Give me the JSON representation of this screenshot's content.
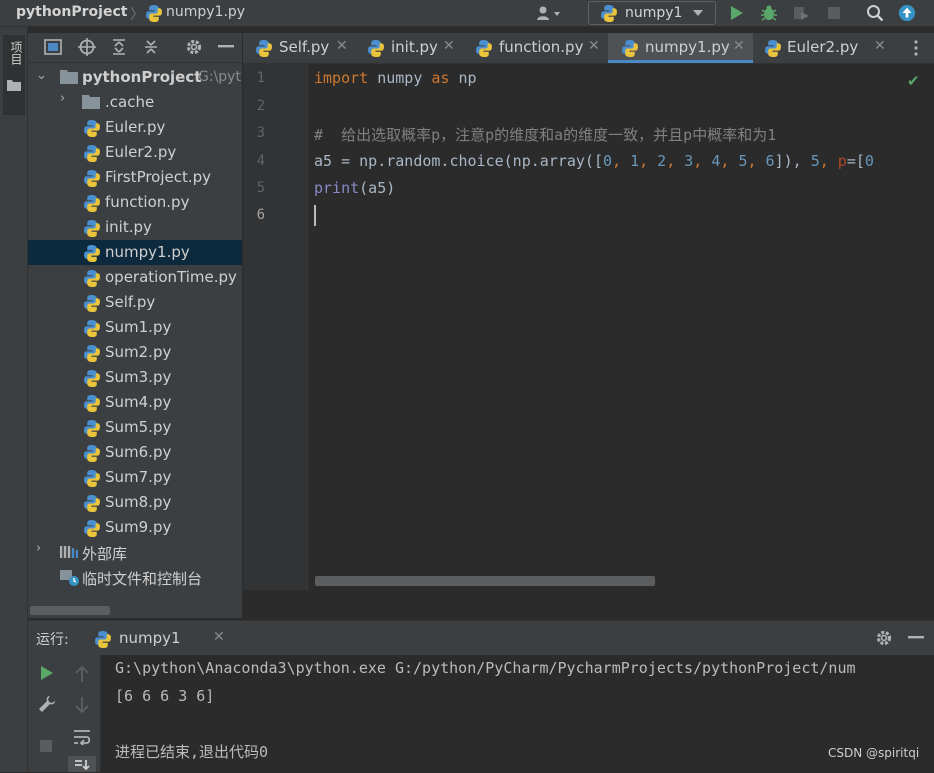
{
  "titlebar": {
    "project": "pythonProject",
    "separator": "〉",
    "file": "numpy1.py",
    "run_config": "numpy1"
  },
  "sidebar_tab": "项目",
  "project_tree": {
    "root": "pythonProject",
    "root_path": "G:\\pyt",
    "cache_folder": ".cache",
    "files": [
      "Euler.py",
      "Euler2.py",
      "FirstProject.py",
      "function.py",
      "init.py",
      "numpy1.py",
      "operationTime.py",
      "Self.py",
      "Sum1.py",
      "Sum2.py",
      "Sum3.py",
      "Sum4.py",
      "Sum5.py",
      "Sum6.py",
      "Sum7.py",
      "Sum8.py",
      "Sum9.py"
    ],
    "selected_file": "numpy1.py",
    "external_libs": "外部库",
    "scratches": "临时文件和控制台"
  },
  "tabs": [
    {
      "label": "Self.py",
      "active": false
    },
    {
      "label": "init.py",
      "active": false
    },
    {
      "label": "function.py",
      "active": false
    },
    {
      "label": "numpy1.py",
      "active": true
    },
    {
      "label": "Euler2.py",
      "active": false
    }
  ],
  "editor": {
    "line_numbers": [
      "1",
      "2",
      "3",
      "4",
      "5",
      "6"
    ],
    "line1": {
      "kw1": "import",
      "mod": " numpy ",
      "kw2": "as",
      "alias": " np"
    },
    "line3": "#  给出选取概率p，注意p的维度和a的维度一致，并且p中概率和为1",
    "line4": {
      "a": "a5 = np.random.choice(np.array([",
      "n0": "0",
      "c0": ", ",
      "n1": "1",
      "c1": ", ",
      "n2": "2",
      "c2": ", ",
      "n3": "3",
      "c3": ", ",
      "n4": "4",
      "c4": ", ",
      "n5": "5",
      "c5": ", ",
      "n6": "6",
      "b": "]), ",
      "n7": "5",
      "c7": ", ",
      "p": "p",
      "eq": "=[",
      "n8": "0"
    },
    "line5": {
      "fn": "print",
      "args": "(a5)"
    }
  },
  "run": {
    "label": "运行:",
    "tab": "numpy1",
    "lines": [
      "G:\\python\\Anaconda3\\python.exe G:/python/PyCharm/PycharmProjects/pythonProject/num",
      "[6 6 6 3 6]",
      "",
      "进程已结束,退出代码0"
    ]
  },
  "watermark": "CSDN @spiritqi",
  "colors": {
    "keyword": "#cc7832",
    "number": "#6897bb",
    "comment": "#808080",
    "builtin": "#8888c6",
    "selection": "#0d293e",
    "run_green": "#59a869",
    "debug_green": "#59a869"
  }
}
